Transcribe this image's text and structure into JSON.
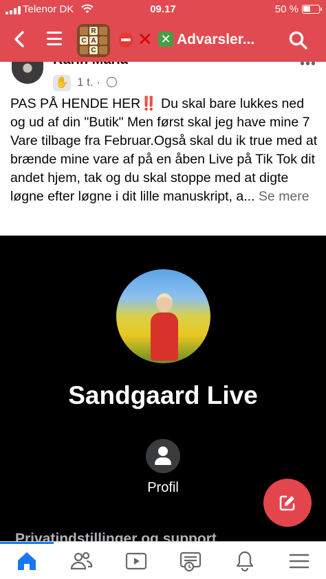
{
  "status_bar": {
    "carrier": "Telenor DK",
    "time": "09.17",
    "battery": "50 %",
    "battery_level": 0.5
  },
  "header": {
    "title": "⛔❌❎Advarsler...",
    "title_text": "Advarsler...",
    "app_icon_letters": [
      "R",
      "C",
      "A",
      "C"
    ]
  },
  "post": {
    "author": "Karin Maria",
    "time": "1 t.",
    "separator": "·",
    "body_prefix": "PAS PÅ HENDE HER",
    "body_bang": "‼️",
    "body_rest": " Du skal bare lukkes ned og ud af din \"Butik\" Men først skal jeg have mine 7 Vare tilbage fra Februar.Også skal du ik true med at brænde mine vare af på en åben Live på Tik Tok dit andet hjem, tak og du skal stoppe med at digte løgne efter løgne i dit lille manuskript, a...",
    "see_more": "Se mere"
  },
  "shared_profile": {
    "name": "Sandgaard Live",
    "profile_label": "Profil",
    "privacy_link": "Privatindstillinger og support"
  },
  "tabs": [
    {
      "name": "home",
      "icon": "home-icon",
      "active": true
    },
    {
      "name": "friends",
      "icon": "friends-icon",
      "active": false
    },
    {
      "name": "watch",
      "icon": "video-icon",
      "active": false
    },
    {
      "name": "news",
      "icon": "news-icon",
      "active": false
    },
    {
      "name": "notifications",
      "icon": "bell-icon",
      "active": false
    },
    {
      "name": "menu",
      "icon": "menu-icon",
      "active": false
    }
  ],
  "colors": {
    "header_bg": "#e14a50",
    "accent": "#1877f2",
    "fab": "#e3454d"
  }
}
